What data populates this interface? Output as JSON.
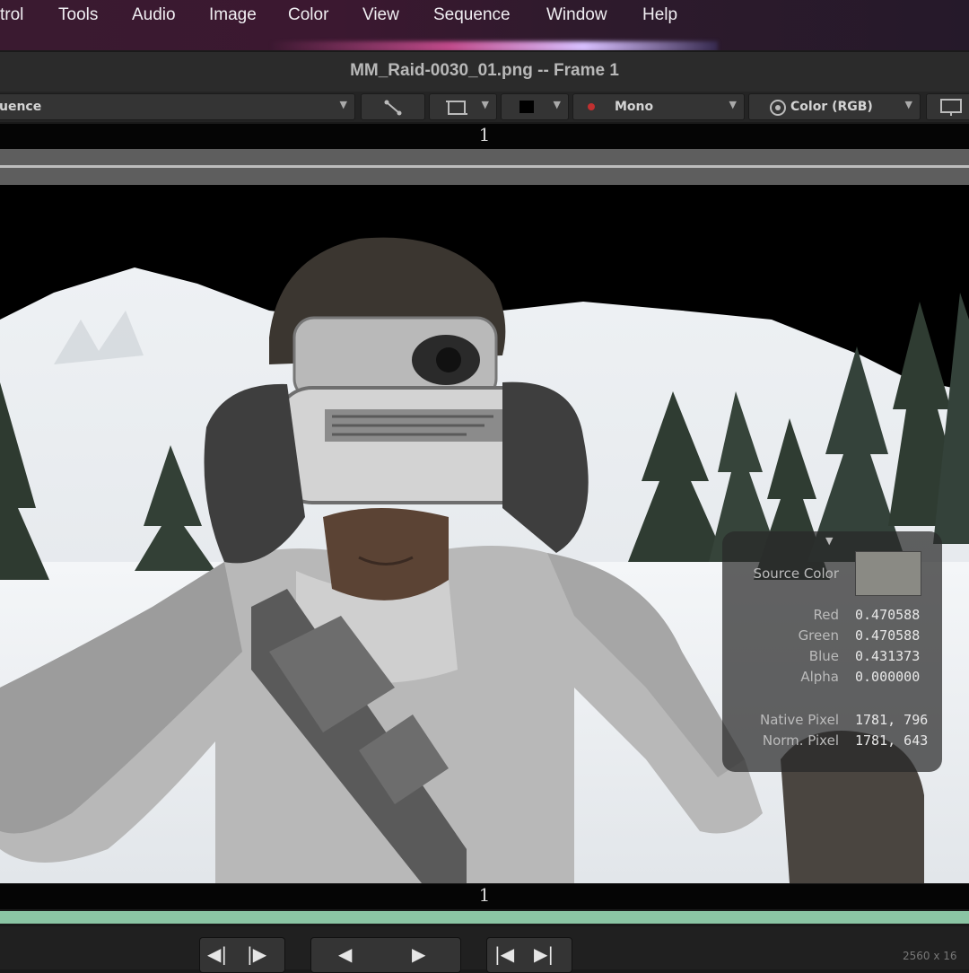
{
  "menubar": {
    "items": [
      "trol",
      "Tools",
      "Audio",
      "Image",
      "Color",
      "View",
      "Sequence",
      "Window",
      "Help"
    ]
  },
  "window": {
    "title": "MM_Raid-0030_01.png -- Frame 1"
  },
  "toolbar": {
    "sequence_label": "uence",
    "mono_label": "Mono",
    "color_label": "Color (RGB)"
  },
  "frame": {
    "top_number": "1",
    "bottom_number": "1"
  },
  "inspector": {
    "source_color_label": "Source Color",
    "swatch_color": "#8a8a84",
    "rows": [
      {
        "label": "Red",
        "value": "0.470588"
      },
      {
        "label": "Green",
        "value": "0.470588"
      },
      {
        "label": "Blue",
        "value": "0.431373"
      },
      {
        "label": "Alpha",
        "value": "0.000000"
      }
    ],
    "native_pixel_label": "Native Pixel",
    "native_pixel_value": "1781, 796",
    "norm_pixel_label": "Norm. Pixel",
    "norm_pixel_value": "1781, 643"
  },
  "status": {
    "resolution": "2560 x 16"
  },
  "colors": {
    "timeline_green": "#8bc5a4",
    "menubar_bg": "#3a1a30"
  }
}
